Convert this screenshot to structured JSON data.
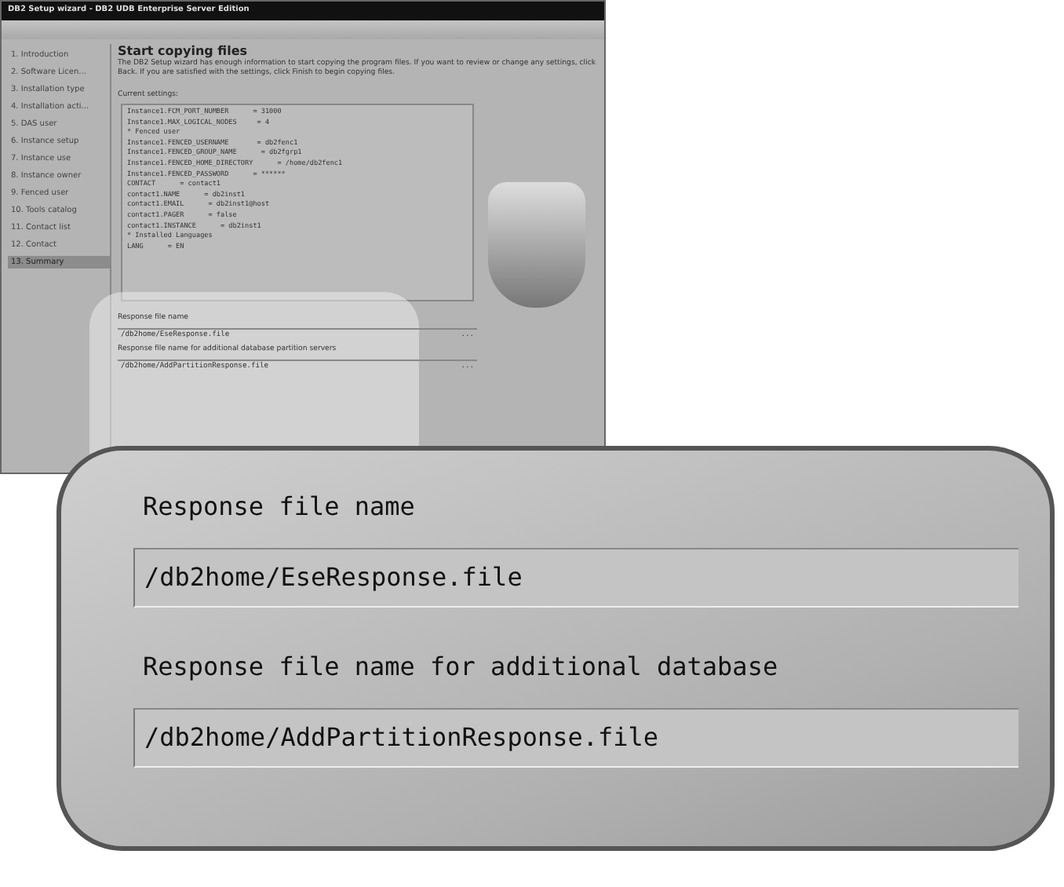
{
  "window": {
    "title": "DB2 Setup wizard - DB2 UDB Enterprise Server Edition"
  },
  "sidebar": {
    "items": [
      {
        "label": "1. Introduction",
        "selected": false
      },
      {
        "label": "2. Software Licen...",
        "selected": false
      },
      {
        "label": "3. Installation type",
        "selected": false
      },
      {
        "label": "4. Installation acti...",
        "selected": false
      },
      {
        "label": "5. DAS user",
        "selected": false
      },
      {
        "label": "6. Instance setup",
        "selected": false
      },
      {
        "label": "7. Instance use",
        "selected": false
      },
      {
        "label": "8. Instance owner",
        "selected": false
      },
      {
        "label": "9. Fenced user",
        "selected": false
      },
      {
        "label": "10. Tools catalog",
        "selected": false
      },
      {
        "label": "11. Contact list",
        "selected": false
      },
      {
        "label": "12. Contact",
        "selected": false
      },
      {
        "label": "13. Summary",
        "selected": true
      }
    ]
  },
  "page": {
    "heading": "Start copying files",
    "intro": "The DB2 Setup wizard has enough information to start copying the program files. If you want to review or change any settings, click Back. If you are satisfied with the settings, click Finish to begin copying files.",
    "settings_label": "Current settings:",
    "settings_lines": [
      "Instance1.FCM_PORT_NUMBER      = 31000",
      "Instance1.MAX_LOGICAL_NODES     = 4",
      "* Fenced user",
      "Instance1.FENCED_USERNAME       = db2fenc1",
      "Instance1.FENCED_GROUP_NAME      = db2fgrp1",
      "Instance1.FENCED_HOME_DIRECTORY      = /home/db2fenc1",
      "Instance1.FENCED_PASSWORD      = ******",
      "CONTACT      = contact1",
      "contact1.NAME      = db2inst1",
      "contact1.EMAIL      = db2inst1@host",
      "contact1.PAGER      = false",
      "contact1.INSTANCE      = db2inst1",
      "* Installed Languages",
      "LANG      = EN"
    ],
    "response_file": {
      "label": "Response file name",
      "value": "/db2home/EseResponse.file",
      "button": "..."
    },
    "additional_response_file": {
      "label": "Response file name for additional database partition servers",
      "value": "/db2home/AddPartitionResponse.file",
      "button": "..."
    }
  },
  "callout": {
    "response_file": {
      "label": "Response file name",
      "value": "/db2home/EseResponse.file"
    },
    "additional_response_file": {
      "label": "Response file name for additional database",
      "value": "/db2home/AddPartitionResponse.file"
    }
  }
}
